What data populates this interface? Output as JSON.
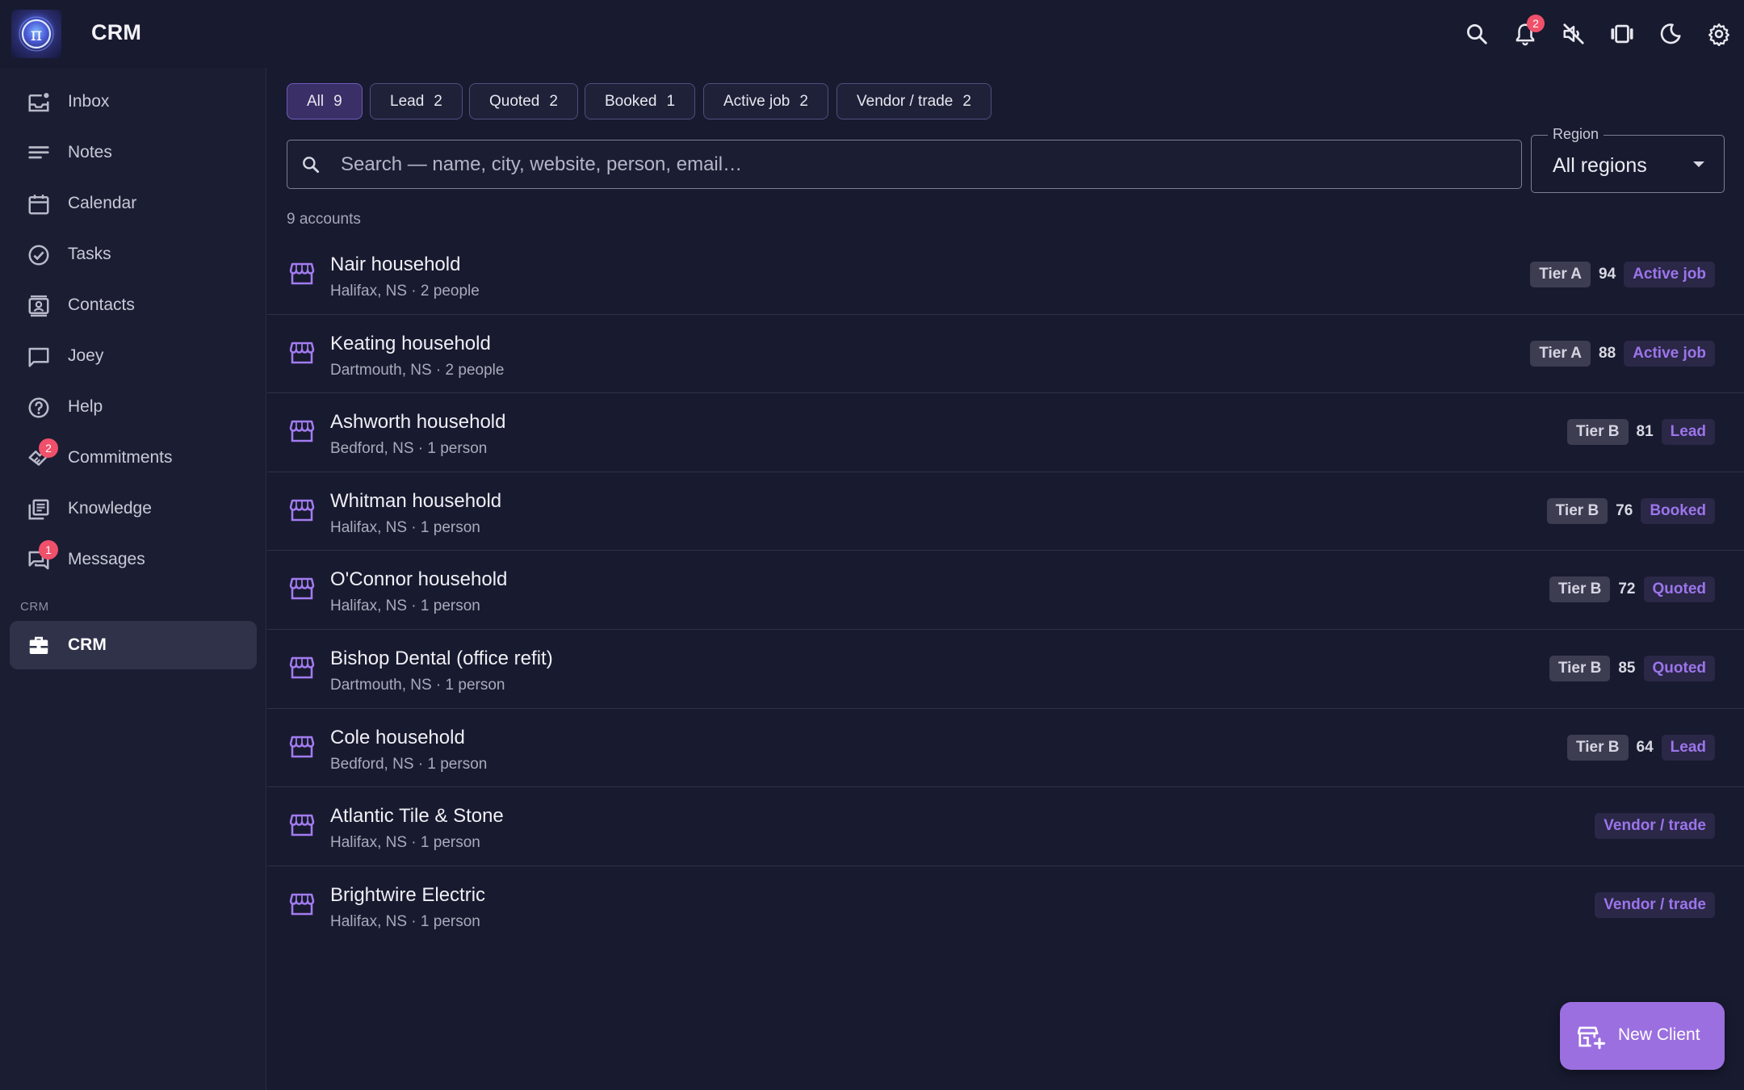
{
  "app": {
    "title": "CRM"
  },
  "topbar": {
    "icons": [
      {
        "name": "search-icon"
      },
      {
        "name": "notifications-icon",
        "badge": "2"
      },
      {
        "name": "mute-icon"
      },
      {
        "name": "carousel-icon"
      },
      {
        "name": "dark-mode-icon"
      },
      {
        "name": "settings-icon"
      }
    ]
  },
  "sidebar": {
    "items": [
      {
        "label": "Inbox",
        "icon": "inbox-icon"
      },
      {
        "label": "Notes",
        "icon": "notes-icon"
      },
      {
        "label": "Calendar",
        "icon": "calendar-icon"
      },
      {
        "label": "Tasks",
        "icon": "check-circle-icon"
      },
      {
        "label": "Contacts",
        "icon": "contacts-icon"
      },
      {
        "label": "Joey",
        "icon": "chat-icon"
      },
      {
        "label": "Help",
        "icon": "help-icon"
      },
      {
        "label": "Commitments",
        "icon": "handshake-icon",
        "badge": "2"
      },
      {
        "label": "Knowledge",
        "icon": "library-icon"
      },
      {
        "label": "Messages",
        "icon": "forum-icon",
        "badge": "1"
      }
    ],
    "section_label": "CRM",
    "active_item": {
      "label": "CRM",
      "icon": "briefcase-icon"
    }
  },
  "filters": [
    {
      "label": "All",
      "count": "9",
      "active": true
    },
    {
      "label": "Lead",
      "count": "2"
    },
    {
      "label": "Quoted",
      "count": "2"
    },
    {
      "label": "Booked",
      "count": "1"
    },
    {
      "label": "Active job",
      "count": "2"
    },
    {
      "label": "Vendor / trade",
      "count": "2"
    }
  ],
  "search": {
    "placeholder": "Search — name, city, website, person, email…",
    "value": ""
  },
  "region": {
    "label": "Region",
    "value": "All regions"
  },
  "account_count": "9 accounts",
  "accounts": [
    {
      "name": "Nair household",
      "sub": "Halifax, NS · 2 people",
      "tier": "Tier A",
      "score": "94",
      "status": "Active job"
    },
    {
      "name": "Keating household",
      "sub": "Dartmouth, NS · 2 people",
      "tier": "Tier A",
      "score": "88",
      "status": "Active job"
    },
    {
      "name": "Ashworth household",
      "sub": "Bedford, NS · 1 person",
      "tier": "Tier B",
      "score": "81",
      "status": "Lead"
    },
    {
      "name": "Whitman household",
      "sub": "Halifax, NS · 1 person",
      "tier": "Tier B",
      "score": "76",
      "status": "Booked"
    },
    {
      "name": "O'Connor household",
      "sub": "Halifax, NS · 1 person",
      "tier": "Tier B",
      "score": "72",
      "status": "Quoted"
    },
    {
      "name": "Bishop Dental (office refit)",
      "sub": "Dartmouth, NS · 1 person",
      "tier": "Tier B",
      "score": "85",
      "status": "Quoted"
    },
    {
      "name": "Cole household",
      "sub": "Bedford, NS · 1 person",
      "tier": "Tier B",
      "score": "64",
      "status": "Lead"
    },
    {
      "name": "Atlantic Tile & Stone",
      "sub": "Halifax, NS · 1 person",
      "tier": "",
      "score": "",
      "status": "Vendor / trade"
    },
    {
      "name": "Brightwire Electric",
      "sub": "Halifax, NS · 1 person",
      "tier": "",
      "score": "",
      "status": "Vendor / trade"
    }
  ],
  "fab": {
    "label": "New Client",
    "icon": "add-business-icon"
  },
  "colors": {
    "accent": "#9b6fe0",
    "badge": "#f0506a",
    "status_text": "#9c75ea"
  }
}
